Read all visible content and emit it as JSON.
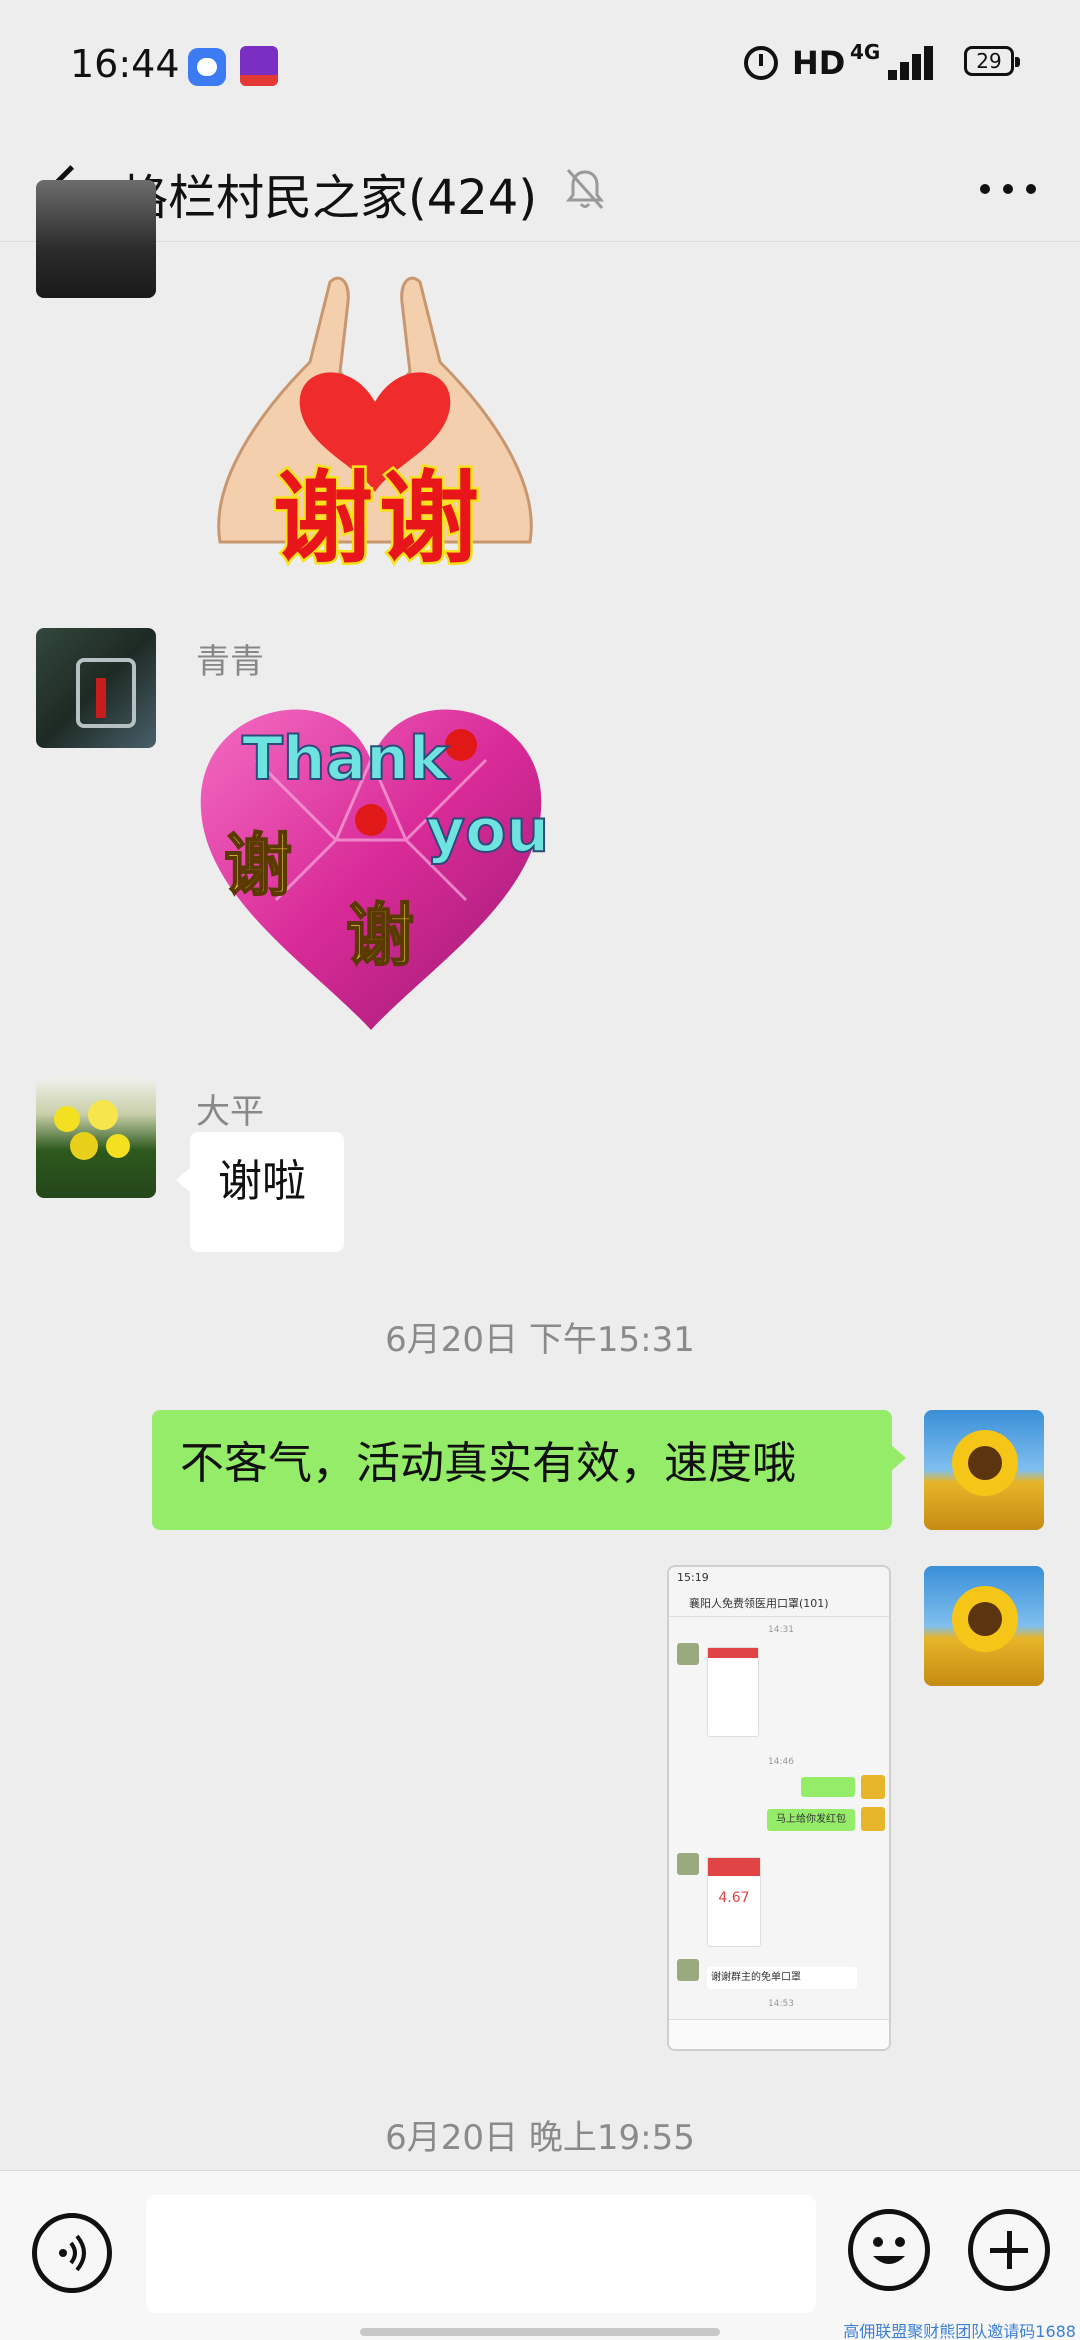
{
  "status_bar": {
    "time": "16:44",
    "network_label": "HD",
    "network_type": "4G",
    "battery": "29"
  },
  "header": {
    "title": "格栏村民之家(424)",
    "mute_icon": "bell-off-icon",
    "more_icon": "more-dots-icon"
  },
  "messages": {
    "sticker1_text": "谢谢",
    "sender2_name": "青青",
    "sticker2_thank": "Thank",
    "sticker2_you": "you",
    "sticker2_xie1": "谢",
    "sticker2_xie2": "谢",
    "sender3_name": "大平",
    "sender3_text": "谢啦",
    "time_separator_1": "6月20日 下午15:31",
    "my_text": "不客气，活动真实有效，速度哦",
    "time_separator_2": "6月20日 晚上19:55"
  },
  "screenshot_thumb": {
    "time": "15:19",
    "title": "襄阳人免费领医用口罩(101)",
    "ts1": "14:31",
    "ts2": "14:46",
    "green_msg": "马上给你发红包",
    "red_amount": "4.67",
    "thank_msg": "谢谢群主的免单口罩",
    "ts3": "14:53"
  },
  "bottom_bar": {
    "voice_icon": "voice-icon",
    "emoji_icon": "emoji-icon",
    "plus_icon": "plus-icon"
  },
  "watermark": "高佣联盟聚财熊团队邀请码1688",
  "colors": {
    "background": "#ededed",
    "my_bubble": "#95ec69",
    "their_bubble": "#ffffff",
    "heart_red": "#ef2b2b",
    "heart_pink": "#e23ea0"
  }
}
